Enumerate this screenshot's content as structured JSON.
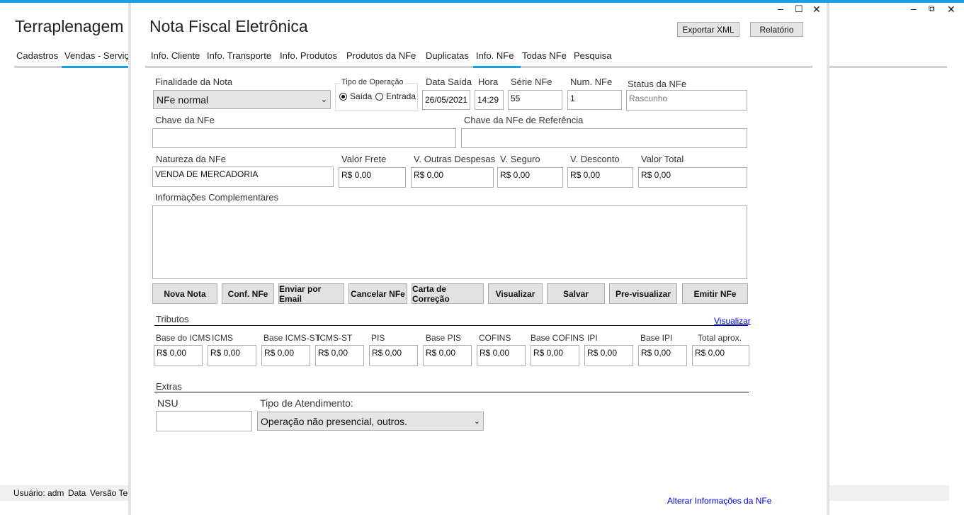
{
  "background": {
    "app_title": "Terraplenagem",
    "tabs": [
      "Cadastros",
      "Vendas - Serviço"
    ],
    "status": [
      "Usuário: adm",
      "Data",
      "Versão Tecr"
    ]
  },
  "dialog": {
    "title": "Nota Fiscal Eletrônica",
    "export_xml": "Exportar XML",
    "report": "Relatório",
    "tabs": [
      "Info. Cliente",
      "Info. Transporte",
      "Info. Produtos",
      "Produtos da NFe",
      "Duplicatas",
      "Info. NFe",
      "Todas NFe",
      "Pesquisa"
    ],
    "active_tab": "Info. NFe"
  },
  "form": {
    "finalidade_label": "Finalidade da Nota",
    "finalidade_value": "NFe normal",
    "tipo_operacao_label": "Tipo de Operação",
    "saida_label": "Saída",
    "entrada_label": "Entrada",
    "tipo_operacao_selected": "Saída",
    "data_saida_label": "Data Saída",
    "data_saida_value": "26/05/2021",
    "hora_label": "Hora",
    "hora_value": "14:29",
    "serie_label": "Série NFe",
    "serie_value": "55",
    "num_label": "Num. NFe",
    "num_value": "1",
    "status_label": "Status da NFe",
    "status_value": "Rascunho",
    "chave_label": "Chave da NFe",
    "chave_value": "",
    "chave_ref_label": "Chave da NFe de Referência",
    "chave_ref_value": "",
    "natureza_label": "Natureza da NFe",
    "natureza_value": "VENDA DE MERCADORIA",
    "frete_label": "Valor Frete",
    "frete_value": "R$ 0,00",
    "outras_label": "V. Outras Despesas",
    "outras_value": "R$ 0,00",
    "seguro_label": "V. Seguro",
    "seguro_value": "R$ 0,00",
    "desconto_label": "V. Desconto",
    "desconto_value": "R$ 0,00",
    "total_label": "Valor Total",
    "total_value": "R$ 0,00",
    "info_comp_label": "Informações Complementares",
    "info_comp_value": ""
  },
  "actions": [
    "Nova Nota",
    "Conf. NFe",
    "Enviar por Email",
    "Cancelar NFe",
    "Carta de Correção",
    "Visualizar",
    "Salvar",
    "Pre-visualizar",
    "Emitir NFe"
  ],
  "tributos": {
    "title": "Tributos",
    "link": "Visualizar",
    "labels": [
      "Base do ICMS",
      "ICMS",
      "Base ICMS-ST",
      "ICMS-ST",
      "PIS",
      "Base PIS",
      "COFINS",
      "Base COFINS",
      "IPI",
      "Base IPI",
      "Total aprox."
    ],
    "values": [
      "R$ 0,00",
      "R$ 0,00",
      "R$ 0,00",
      "R$ 0,00",
      "R$ 0,00",
      "R$ 0,00",
      "R$ 0,00",
      "R$ 0,00",
      "R$ 0,00",
      "R$ 0,00",
      "R$ 0,00"
    ]
  },
  "extras": {
    "title": "Extras",
    "nsu_label": "NSU",
    "nsu_value": "",
    "atendimento_label": "Tipo de Atendimento:",
    "atendimento_value": "Operação não presencial, outros."
  },
  "footer_link": "Alterar Informações da NFe",
  "colors": {
    "accent": "#1ba1e2",
    "link": "#0000ee",
    "button_bg": "#e1e1e1"
  }
}
